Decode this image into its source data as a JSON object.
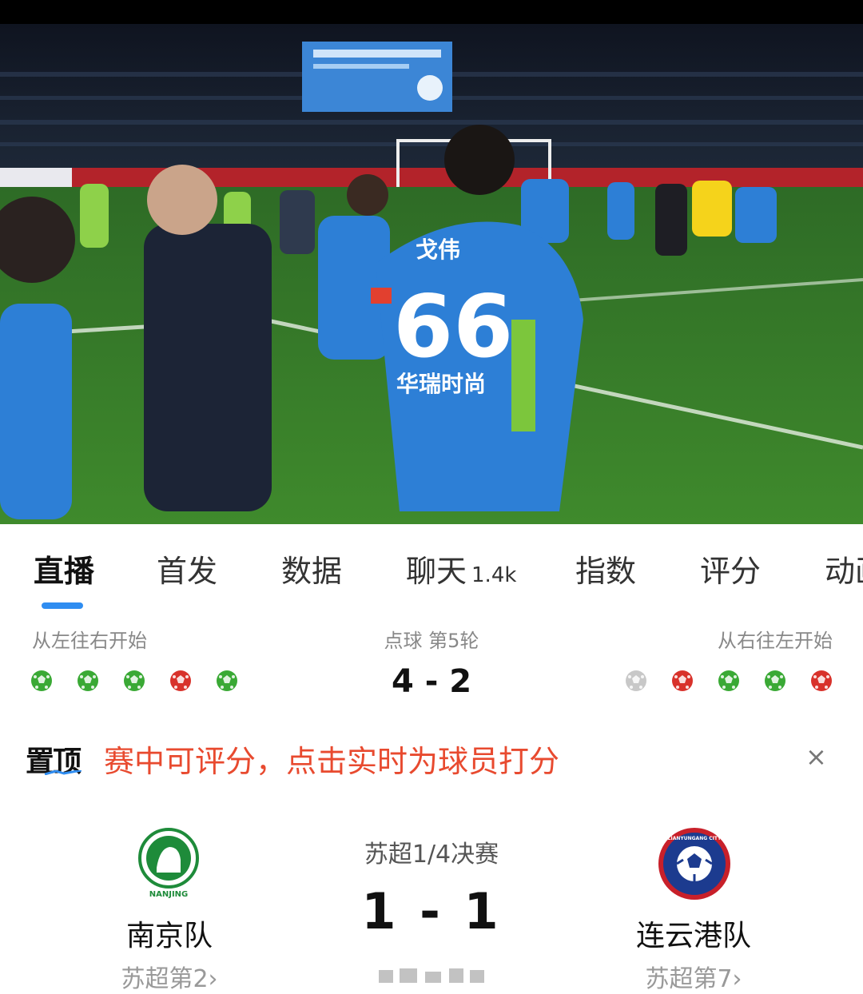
{
  "video": {
    "jersey_name": "戈伟",
    "jersey_number": "66",
    "jersey_sponsor": "华瑞时尚",
    "accent_color": "#2d7fd6"
  },
  "tabs": [
    {
      "label": "直播",
      "active": true
    },
    {
      "label": "首发"
    },
    {
      "label": "数据"
    },
    {
      "label": "聊天",
      "count": "1.4k"
    },
    {
      "label": "指数"
    },
    {
      "label": "评分"
    },
    {
      "label": "动画"
    }
  ],
  "penalty": {
    "left_note": "从左往右开始",
    "center_note": "点球 第5轮",
    "right_note": "从右往左开始",
    "score": "4 - 2",
    "home_kicks": [
      "scored",
      "scored",
      "scored",
      "missed",
      "scored"
    ],
    "away_kicks": [
      "pending",
      "missed",
      "scored",
      "scored",
      "missed"
    ],
    "colors": {
      "scored": "#3aa935",
      "missed": "#d8322b",
      "pending": "#c8c8c8"
    }
  },
  "pinned": {
    "tag": "置顶",
    "text": "赛中可评分，点击实时为球员打分",
    "close": "×"
  },
  "match": {
    "competition": "苏超1/4决赛",
    "score": "1 - 1",
    "home": {
      "name": "南京队",
      "rank": "苏超第2",
      "logo_text": "NANJING",
      "logo_color": "#1e8b3a"
    },
    "away": {
      "name": "连云港队",
      "rank": "苏超第7",
      "logo_text": "LIANYUNGANG CITY",
      "logo_color": "#c8202a"
    }
  }
}
